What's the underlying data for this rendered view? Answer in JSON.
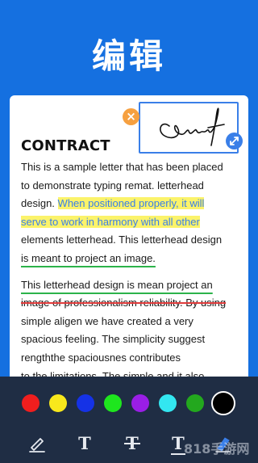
{
  "heading": "编辑",
  "document": {
    "title": "CONTRACT",
    "paragraph1": {
      "line1": "This is a sample letter that has been placed",
      "line2": "to demonstrate typing remat. letterhead",
      "line3_plain": "design. ",
      "line3_highlight": "When positioned properly, it will",
      "line4_highlight": "serve to work in harmony with all other",
      "line5": "elements letterhead. This letterhead design",
      "line6_underlined": "is meant to project an image."
    },
    "paragraph2": {
      "line1_underlined": "This letterhead design is mean project an",
      "line2_strikethrough": "image of professionalism reliability. By using",
      "line3": "simple aligen we have created a very",
      "line4": "spacious feeling. The simplicity suggest",
      "line5": "rengththe spaciousnes contributes",
      "line6_partial": "to  the  limitations.  The  simple  and  it  also"
    }
  },
  "signature": {
    "close_symbol": "×"
  },
  "colors": {
    "background": "#1570e0",
    "toolbar": "#1f2d44",
    "highlight": "#fbf36a",
    "highlight_text": "#3a7fe8",
    "underline": "#2cb34a",
    "strikethrough": "#e03b3b",
    "palette": [
      "#f01e1e",
      "#f8e81c",
      "#1532e6",
      "#1ee61e",
      "#9a1ee6",
      "#33e6f0",
      "#23a81e",
      "#000000"
    ]
  },
  "toolbar": {
    "selected_color_index": 7,
    "tools": [
      {
        "icon": "pen-icon"
      },
      {
        "icon": "text-icon",
        "glyph": "T"
      },
      {
        "icon": "strikethrough-icon",
        "glyph": "T"
      },
      {
        "icon": "underline-icon",
        "glyph": "T"
      },
      {
        "icon": "signature-pen-icon"
      }
    ]
  },
  "watermark": "818手游网"
}
